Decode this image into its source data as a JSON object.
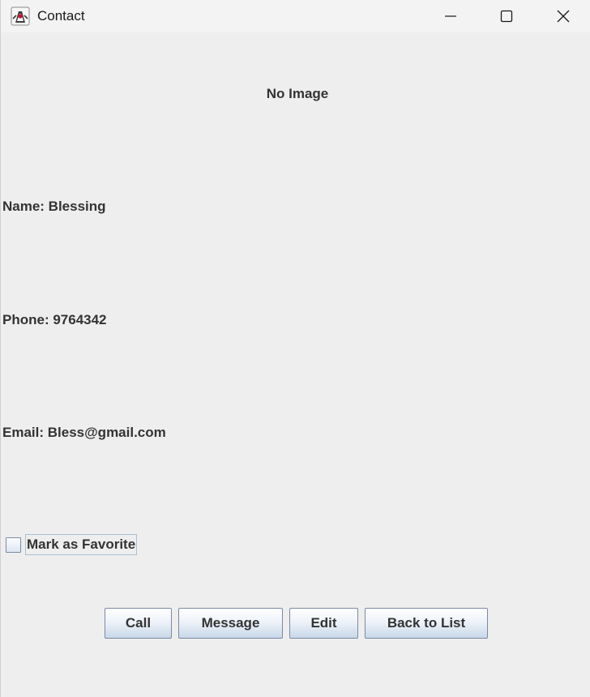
{
  "window": {
    "title": "Contact",
    "icon": "java-duke-icon",
    "controls": [
      "minimize-icon",
      "maximize-icon",
      "close-icon"
    ]
  },
  "contact": {
    "image_placeholder": "No Image",
    "name": "Name: Blessing",
    "phone": "Phone: 9764342",
    "email": "Email: Bless@gmail.com"
  },
  "favorite": {
    "label": "Mark as Favorite",
    "checked": false
  },
  "buttons": {
    "call": "Call",
    "message": "Message",
    "edit": "Edit",
    "back": "Back to List"
  },
  "colors": {
    "background": "#eeeeee",
    "titlebar": "#f3f3f3",
    "text": "#333333",
    "button_border": "#7a8aa3"
  }
}
